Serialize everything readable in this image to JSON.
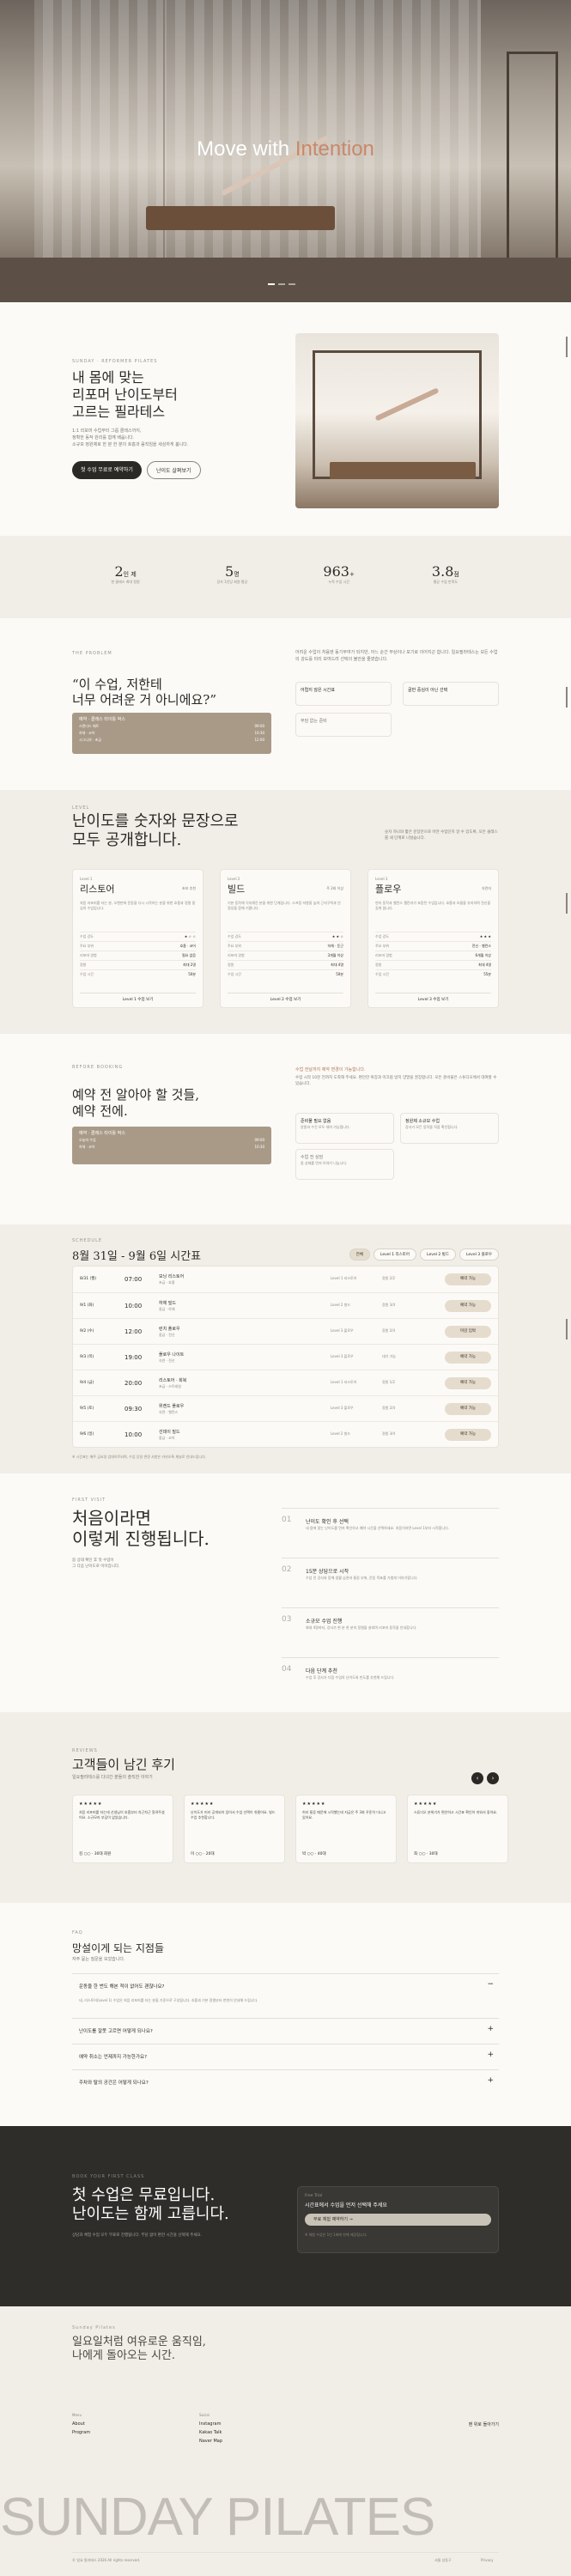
{
  "hero": {
    "title_start": "Move with ",
    "title_accent": "Intention"
  },
  "intro": {
    "eyebrow": "Sunday · Reformer Pilates",
    "heading": [
      "내 몸에 맞는",
      "리포머 난이도부터",
      "고르는 필라테스"
    ],
    "desc": [
      "1:1 리포머 수업부터 그룹 클래스까지,",
      "정확한 동작 원리를 함께 배웁니다.",
      "소규모 정원제로 한 분 한 분의 호흡과 움직임을 세심하게 봅니다."
    ],
    "btn_primary": "첫 수업 무료로 예약하기",
    "btn_secondary": "난이도 살펴보기"
  },
  "stats": [
    {
      "num": "2",
      "unit": "인 제",
      "label": "한 클래스 최대 정원"
    },
    {
      "num": "5",
      "unit": "명",
      "label": "강사 1인당 회원 평균"
    },
    {
      "num": "963",
      "unit": "+",
      "label": "누적 수업 시간"
    },
    {
      "num": "3.8",
      "unit": "점",
      "label": "평균 수업 만족도"
    }
  ],
  "problem": {
    "eyebrow": "The Problem",
    "quote": [
      "“이 수업, 저한테",
      "너무 어려운 거 아니에요?”"
    ],
    "card_title": "예약 · 클래스 타이틀 박스",
    "card_rows": [
      [
        "스탠다드 매트",
        "09:00"
      ],
      [
        "하체 · 코어",
        "10:30"
      ],
      [
        "시그니처 · 초급",
        "12:00"
      ]
    ],
    "desc": "어려운 수업이 처음엔 동기부여가 되지만, 어느 순간 부상이나 포기로 이어지곤 합니다. 일요필라테스는 모든 수업의 강도를 미리 보여드려 선택의 불안을 줄였습니다.",
    "tags": [
      "어렵지 않은 시간표",
      "골반 중심이 아닌 선택",
      "부담 없는 준비"
    ]
  },
  "levels": {
    "eyebrow": "Level",
    "heading": [
      "난이도를 숫자와 문장으로",
      "모두 공개합니다."
    ],
    "note": "숫자 하나와 짧은 문장만으로 어떤 수업인지 알 수 있도록, 모든 클래스를 세 단계로 나눴습니다.",
    "cards": [
      {
        "name": "리스토어",
        "tag": "초보 추천",
        "step": "Level 1",
        "desc": "처음 리포머를 타는 분, 오랜만에 운동을 다시 시작하는 분을 위한 호흡과 정렬 중심의 수업입니다.",
        "rows": [
          [
            "수업 강도",
            "★ ☆ ☆"
          ],
          [
            "주요 부위",
            "호흡 · 코어"
          ],
          [
            "리포머 경험",
            "필요 없음"
          ],
          [
            "정원",
            "최대 2명"
          ],
          [
            "수업 시간",
            "50분"
          ]
        ],
        "footer": "Level 1 수업 보기"
      },
      {
        "name": "빌드",
        "tag": "주 2회 이상",
        "step": "Level 2",
        "desc": "기본 동작에 익숙해진 분을 위한 단계입니다. 스프링 저항을 높여 근지구력과 안정성을 함께 기릅니다.",
        "rows": [
          [
            "수업 강도",
            "★ ★ ☆"
          ],
          [
            "주요 부위",
            "하체 · 둔근"
          ],
          [
            "리포머 경험",
            "3개월 이상"
          ],
          [
            "정원",
            "최대 4명"
          ],
          [
            "수업 시간",
            "50분"
          ]
        ],
        "footer": "Level 2 수업 보기"
      },
      {
        "name": "플로우",
        "tag": "숙련자",
        "step": "Level 3",
        "desc": "연속 동작과 밸런스 챌린지가 포함된 수업입니다. 호흡과 흐름을 유지하며 전신을 길게 씁니다.",
        "rows": [
          [
            "수업 강도",
            "★ ★ ★"
          ],
          [
            "주요 부위",
            "전신 · 밸런스"
          ],
          [
            "리포머 경험",
            "6개월 이상"
          ],
          [
            "정원",
            "최대 4명"
          ],
          [
            "수업 시간",
            "55분"
          ]
        ],
        "footer": "Level 3 수업 보기"
      }
    ]
  },
  "checklist": {
    "eyebrow": "Before Booking",
    "heading": [
      "예약 전 알아야 할 것들,",
      "예약 전에."
    ],
    "card_title": "예약 · 클래스 타이틀 박스",
    "card_rows": [
      [
        "오늘의 수업",
        "09:00"
      ],
      [
        "하체 · 코어",
        "10:30"
      ]
    ],
    "link": "수업 전날까지 예약 변경이 가능합니다.",
    "desc": "수업 시작 10분 전까지 도착해 주세요. 편안한 복장과 미끄럼 방지 양말을 권장합니다. 모든 준비물은 스튜디오에서 대여할 수 있습니다.",
    "items": [
      {
        "t": "준비물 필요 없음",
        "d": "양말과 수건 모두 대여 가능합니다."
      },
      {
        "t": "정원제 소규모 수업",
        "d": "강사가 모든 동작을 직접 확인합니다."
      },
      {
        "t": "수업 전 상담",
        "d": "몸 상태를 먼저 이야기 나눕니다."
      }
    ]
  },
  "schedule": {
    "eyebrow": "Schedule",
    "title": "8월 31일 - 9월 6일 시간표",
    "filters": [
      "전체",
      "Level 1 리스토어",
      "Level 2 빌드",
      "Level 3 플로우"
    ],
    "rows": [
      [
        "8/31 (월)",
        "07:00",
        "모닝 리스토어",
        "초급 · 호흡",
        "Level 1 리스토어",
        "정원 2/2",
        "예약 가능"
      ],
      [
        "9/1 (화)",
        "10:00",
        "하체 빌드",
        "중급 · 하체",
        "Level 2 빌드",
        "정원 3/4",
        "예약 가능"
      ],
      [
        "9/2 (수)",
        "12:00",
        "런치 플로우",
        "중급 · 전신",
        "Level 3 플로우",
        "정원 2/4",
        "마감 임박"
      ],
      [
        "9/3 (목)",
        "19:00",
        "플로우 나이트",
        "숙련 · 전신",
        "Level 3 플로우",
        "대기 가능",
        "예약 가능"
      ],
      [
        "9/4 (금)",
        "20:00",
        "리스토어 · 회복",
        "초급 · 스트레칭",
        "Level 1 리스토어",
        "정원 1/2",
        "예약 가능"
      ],
      [
        "9/5 (토)",
        "09:30",
        "위켄드 플로우",
        "숙련 · 밸런스",
        "Level 3 플로우",
        "정원 2/4",
        "예약 가능"
      ],
      [
        "9/6 (일)",
        "10:00",
        "선데이 빌드",
        "중급 · 코어",
        "Level 2 빌드",
        "정원 3/4",
        "예약 가능"
      ]
    ],
    "note": "※ 시간표는 매주 금요일 업데이트되며, 수업 당일 변경 사항은 카카오톡 채널로 안내드립니다."
  },
  "process": {
    "eyebrow": "First Visit",
    "heading": [
      "처음이라면",
      "이렇게 진행됩니다."
    ],
    "sub": [
      "몸 상태 확인 후 첫 수업이",
      "그 다음 난이도로 이어집니다."
    ],
    "steps": [
      {
        "n": "01",
        "t": "난이도 확인 후 선택",
        "d": "내 몸에 맞는 난이도를 먼저 확인하고 예약 시간을 선택하세요. 처음이라면 Level 1부터 시작합니다."
      },
      {
        "n": "02",
        "t": "15분 상담으로 시작",
        "d": "수업 전 강사와 함께 생활 습관과 통증 부위, 운동 목표를 가볍게 이야기합니다."
      },
      {
        "n": "03",
        "t": "소규모 수업 진행",
        "d": "최대 4명까지, 강사가 한 분 한 분의 정렬을 살피며 리포머 동작을 안내합니다."
      },
      {
        "n": "04",
        "t": "다음 단계 추천",
        "d": "수업 후 강사가 다음 수업의 난이도와 빈도를 추천해 드립니다."
      }
    ]
  },
  "reviews": {
    "eyebrow": "Reviews",
    "title": "고객들이 남긴 후기",
    "sub": "일요필라테스를 다녀간 분들의 솔직한 이야기",
    "items": [
      {
        "stars": "★★★★★",
        "text": "처음 리포머를 타는데 선생님이 호흡부터 차근차근 알려주셨어요. 소규모라 부담이 없었습니다.",
        "who": "김 ○○ · 30대 회원"
      },
      {
        "stars": "★★★★★",
        "text": "난이도가 미리 공개되어 있어서 수업 선택이 쉬웠어요. 빌드 수업 추천합니다.",
        "who": "이 ○○ · 20대"
      },
      {
        "stars": "★★★★★",
        "text": "허리 통증 때문에 시작했는데 지금은 주 3회 꾸준히 다니고 있어요.",
        "who": "박 ○○ · 40대"
      },
      {
        "stars": "★★★★★",
        "text": "스튜디오 분위기가 편안하고 시간표 확인이 쉬워서 좋아요.",
        "who": "최 ○○ · 30대"
      }
    ]
  },
  "faq": {
    "eyebrow": "FAQ",
    "title": "망설이게 되는 지점들",
    "sub": "자주 묻는 질문을 모았습니다.",
    "items": [
      {
        "q": "운동을 한 번도 해본 적이 없어도 괜찮나요?",
        "a": "네, 리스토어(Level 1) 수업은 처음 리포머를 타는 분을 기준으로 구성됩니다. 호흡과 기본 정렬부터 천천히 안내해 드립니다.",
        "open": "−"
      },
      {
        "q": "난이도를 잘못 고르면 어떻게 되나요?",
        "a": "",
        "open": "+"
      },
      {
        "q": "예약 취소는 언제까지 가능한가요?",
        "a": "",
        "open": "+"
      },
      {
        "q": "주차와 탈의 공간은 어떻게 되나요?",
        "a": "",
        "open": "+"
      }
    ]
  },
  "cta": {
    "eyebrow": "Book your first class",
    "heading": [
      "첫 수업은 무료입니다.",
      "난이도는 함께 고릅니다."
    ],
    "desc": "상담과 체험 수업 모두 무료로 진행됩니다. 부담 없이 편한 시간을 선택해 주세요.",
    "card_label": "Free Trial",
    "card_title": "시간표에서 수업을 먼저 선택해 주세요",
    "card_btn": "무료 체험 예약하기",
    "card_note": "※ 체험 수업은 1인 1회에 한해 제공됩니다."
  },
  "footer": {
    "brand_small": "Sunday Pilates",
    "tagline": [
      "일요일처럼 여유로운 움직임,",
      "나에게 돌아오는 시간."
    ],
    "col1_title": "Menu",
    "col1": [
      "About",
      "Program"
    ],
    "col2_title": "Social",
    "col2": [
      "Instagram",
      "Kakao Talk",
      "Naver Map"
    ],
    "top_link": "맨 위로 돌아가기",
    "brand_big": "SUNDAY PILATES",
    "copy": "© 일요 필라테스 2026 All rights reserved.",
    "addr": "서울 성동구",
    "legal": "Privacy"
  }
}
